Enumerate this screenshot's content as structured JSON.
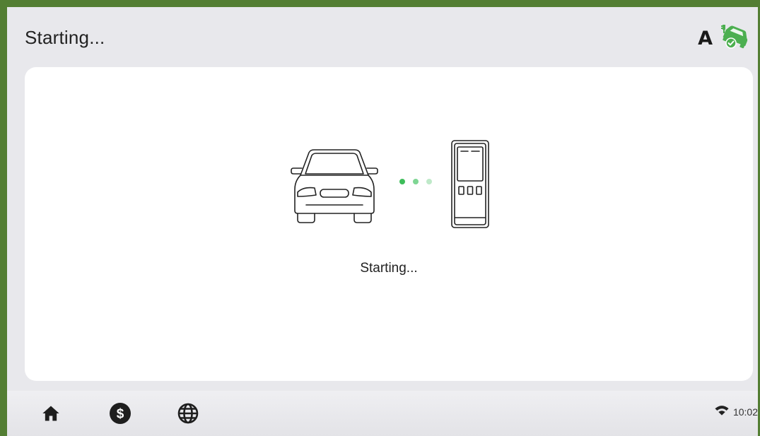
{
  "app": {
    "title": "Starting...",
    "connector_label": "A",
    "accent_color": "#4caf50",
    "frame_color": "#537e33"
  },
  "main": {
    "status_text": "Starting...",
    "illustration": {
      "left": "car-icon",
      "middle": "progress-dots",
      "right": "charger-icon"
    }
  },
  "footer": {
    "nav": [
      {
        "name": "home",
        "icon": "home-icon"
      },
      {
        "name": "billing",
        "icon": "dollar-icon"
      },
      {
        "name": "language",
        "icon": "globe-icon"
      }
    ],
    "time": "10:02",
    "wifi_icon": "wifi-icon"
  }
}
